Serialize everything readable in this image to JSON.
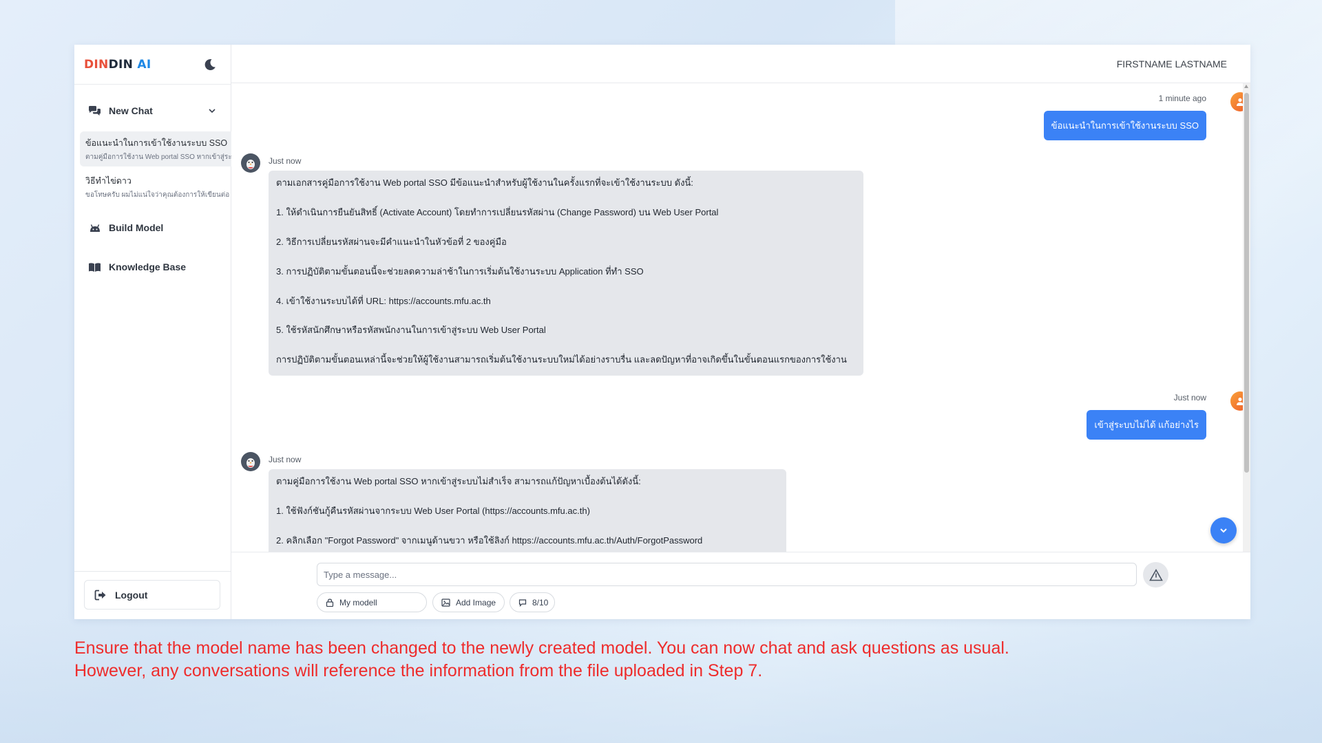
{
  "colors": {
    "accent": "#3b82f6",
    "logo_orange": "#e8503a",
    "logo_blue": "#1e88e5",
    "logo_dark": "#1f2a3a",
    "caption_red": "#ee2c2c"
  },
  "sidebar": {
    "logo_part1": "DIN",
    "logo_part2": "DIN",
    "logo_part3": "AI",
    "theme_toggle_icon": "moon-icon",
    "new_chat_label": "New Chat",
    "chats": [
      {
        "title": "ข้อแนะนำในการเข้าใช้งานระบบ SSO",
        "preview": "ตามคู่มือการใช้งาน Web portal SSO หากเข้าสู่ระ"
      },
      {
        "title": "วิธีทำไข่ดาว",
        "preview": "ขอโทษครับ ผมไม่แน่ใจว่าคุณต้องการให้เขียนต่อ"
      }
    ],
    "build_model_label": "Build Model",
    "knowledge_base_label": "Knowledge Base",
    "logout_label": "Logout"
  },
  "header": {
    "user_name": "FIRSTNAME LASTNAME"
  },
  "messages": [
    {
      "role": "user",
      "time": "1 minute ago",
      "text": "ข้อแนะนำในการเข้าใช้งานระบบ SSO"
    },
    {
      "role": "assistant",
      "time": "Just now",
      "paragraphs": [
        "ตามเอกสารคู่มือการใช้งาน Web portal SSO มีข้อแนะนำสำหรับผู้ใช้งานในครั้งแรกที่จะเข้าใช้งานระบบ ดังนี้:",
        "1. ให้ดำเนินการยืนยันสิทธิ์ (Activate Account) โดยทำการเปลี่ยนรหัสผ่าน (Change Password) บน Web User Portal",
        "2. วิธีการเปลี่ยนรหัสผ่านจะมีคำแนะนำในหัวข้อที่ 2 ของคู่มือ",
        "3. การปฏิบัติตามขั้นตอนนี้จะช่วยลดความล่าช้าในการเริ่มต้นใช้งานระบบ Application ที่ทำ SSO",
        "4. เข้าใช้งานระบบได้ที่ URL: https://accounts.mfu.ac.th",
        "5. ใช้รหัสนักศึกษาหรือรหัสพนักงานในการเข้าสู่ระบบ Web User Portal",
        "การปฏิบัติตามขั้นตอนเหล่านี้จะช่วยให้ผู้ใช้งานสามารถเริ่มต้นใช้งานระบบใหม่ได้อย่างราบรื่น และลดปัญหาที่อาจเกิดขึ้นในขั้นตอนแรกของการใช้งาน"
      ]
    },
    {
      "role": "user",
      "time": "Just now",
      "text": "เข้าสู่ระบบไม่ได้ แก้อย่างไร"
    },
    {
      "role": "assistant",
      "time": "Just now",
      "paragraphs": [
        "ตามคู่มือการใช้งาน Web portal SSO หากเข้าสู่ระบบไม่สำเร็จ สามารถแก้ปัญหาเบื้องต้นได้ดังนี้:",
        "1. ใช้ฟังก์ชันกู้คืนรหัสผ่านจากระบบ Web User Portal (https://accounts.mfu.ac.th)",
        "2. คลิกเลือก \"Forgot Password\" จากเมนูด้านขวา หรือใช้ลิงก์ https://accounts.mfu.ac.th/Auth/ForgotPassword"
      ]
    }
  ],
  "composer": {
    "placeholder": "Type a message...",
    "model_label": "My modell",
    "add_image_label": "Add Image",
    "usage_label": "8/10"
  },
  "caption": {
    "line1": "Ensure that the model name has been changed to the newly created model. You can now chat and ask questions as usual.",
    "line2": "However, any conversations will reference the information from the file uploaded in Step 7."
  }
}
